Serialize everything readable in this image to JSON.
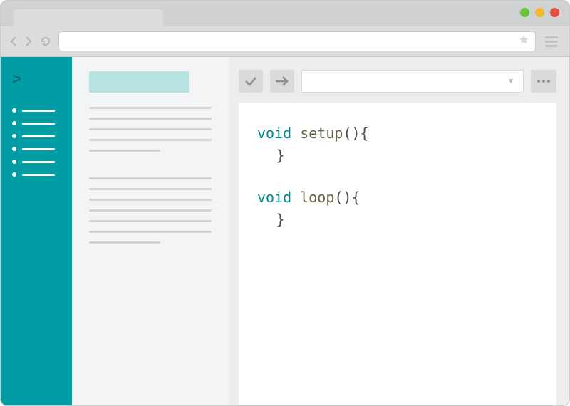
{
  "colors": {
    "teal": "#009da5",
    "tealDark": "#006b71",
    "highlight": "#b6e2e1"
  },
  "sidebar": {
    "item_count": 6
  },
  "midpanel": {
    "group1_lines": 5,
    "group2_lines": 7
  },
  "editor": {
    "lines": [
      {
        "tokens": [
          {
            "t": "void",
            "c": "kw"
          },
          {
            "t": " ",
            "c": ""
          },
          {
            "t": "setup",
            "c": "fn"
          },
          {
            "t": "(){",
            "c": "brace"
          }
        ]
      },
      {
        "tokens": [
          {
            "t": " }",
            "c": "brace"
          }
        ],
        "indent": true
      },
      {
        "blank": true
      },
      {
        "tokens": [
          {
            "t": "void",
            "c": "kw"
          },
          {
            "t": " ",
            "c": ""
          },
          {
            "t": "loop",
            "c": "fn"
          },
          {
            "t": "(){",
            "c": "brace"
          }
        ]
      },
      {
        "tokens": [
          {
            "t": " }",
            "c": "brace"
          }
        ],
        "indent": true
      }
    ]
  },
  "toolbar": {
    "verify_title": "Verify",
    "upload_title": "Upload",
    "board_placeholder": "",
    "more_title": "More"
  }
}
